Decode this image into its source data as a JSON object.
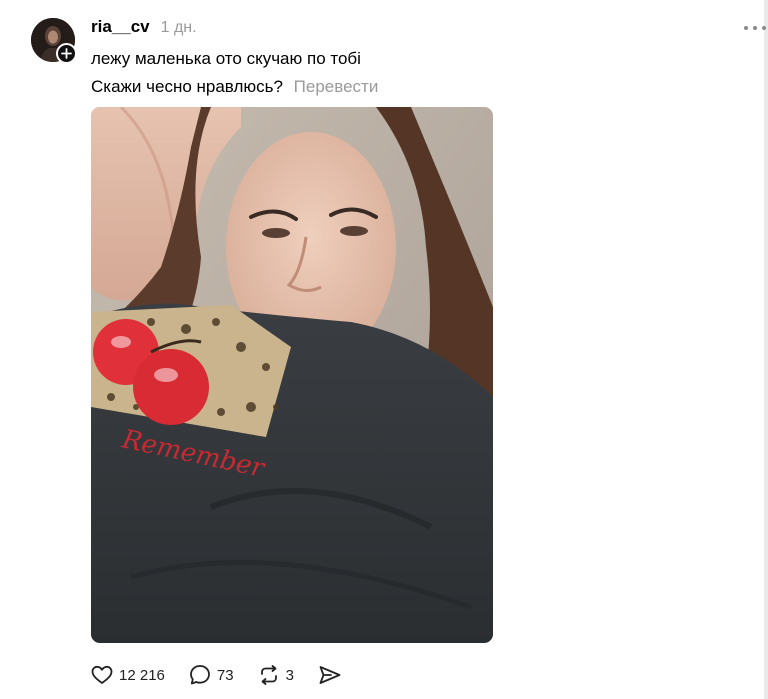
{
  "post": {
    "username": "ria__cv",
    "time": "1 дн.",
    "text_line1": "лежу маленька ото скучаю по тобі",
    "text_line2": "Скажи чесно нравлюсь?",
    "translate_label": "Перевести",
    "photo_shirt_text": "Remember",
    "actions": {
      "likes": "12 216",
      "comments": "73",
      "reposts": "3"
    }
  },
  "icons": {
    "follow": "plus-icon",
    "more": "more-dots-icon",
    "like": "heart-icon",
    "comment": "comment-bubble-icon",
    "repost": "repost-icon",
    "share": "send-icon"
  },
  "colors": {
    "text": "#000000",
    "muted": "#9a9a9a",
    "background": "#ffffff"
  }
}
